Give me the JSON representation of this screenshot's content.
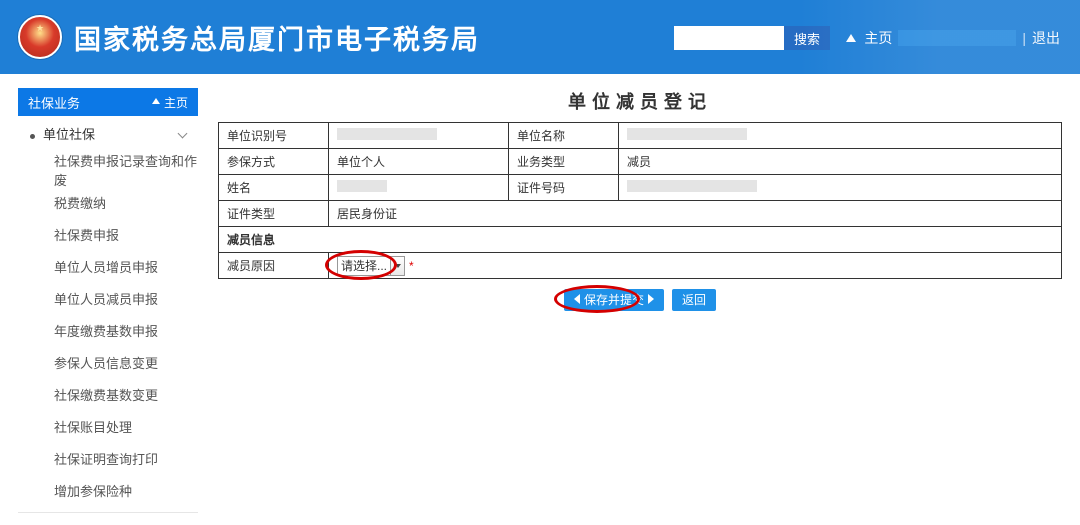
{
  "header": {
    "title": "国家税务总局厦门市电子税务局",
    "search_label": "搜索",
    "home_label": "主页",
    "logout_label": "退出"
  },
  "nav": {
    "module": "社保业务",
    "home_label": "主页",
    "group_label": "单位社保",
    "items": [
      "社保费申报记录查询和作废",
      "税费缴纳",
      "社保费申报",
      "单位人员增员申报",
      "单位人员减员申报",
      "年度缴费基数申报",
      "参保人员信息变更",
      "社保缴费基数变更",
      "社保账目处理",
      "社保证明查询打印",
      "增加参保险种"
    ]
  },
  "page": {
    "title": "单位减员登记"
  },
  "form": {
    "unit_id_label": "单位识别号",
    "unit_name_label": "单位名称",
    "insure_mode_label": "参保方式",
    "insure_mode_value": "单位个人",
    "biz_type_label": "业务类型",
    "biz_type_value": "减员",
    "name_label": "姓名",
    "cert_no_label": "证件号码",
    "cert_type_label": "证件类型",
    "cert_type_value": "居民身份证",
    "section_label": "减员信息",
    "reason_label": "减员原因",
    "reason_placeholder": "请选择..."
  },
  "buttons": {
    "submit": "保存并提交",
    "back": "返回"
  }
}
